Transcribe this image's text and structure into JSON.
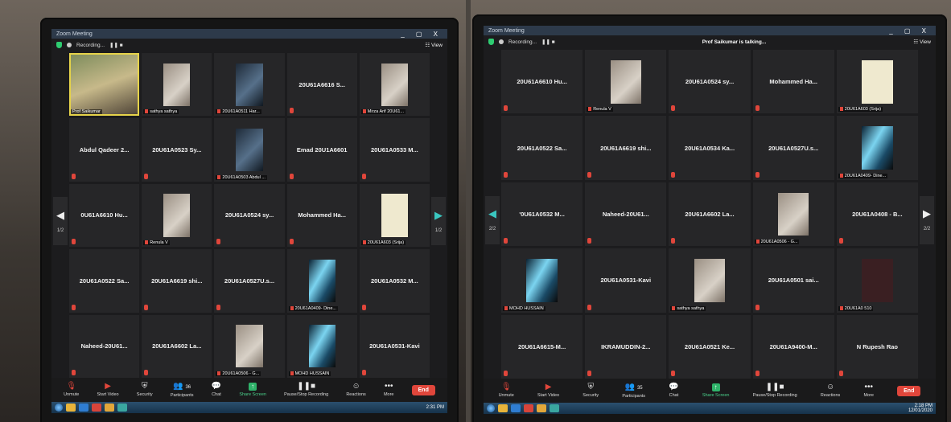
{
  "left": {
    "window_title": "Zoom Meeting",
    "window_controls": "_ ▢ X",
    "recording_label": "Recording...",
    "view_label": "View",
    "talking": "",
    "page_indicator_left": "1/2",
    "page_indicator_right": "1/2",
    "tiles": [
      {
        "kind": "video",
        "label": "Prof Saikumar",
        "active": true,
        "thumb": "full"
      },
      {
        "kind": "video",
        "label": "sathya sathya",
        "thumb": "normal"
      },
      {
        "kind": "video",
        "label": "20U61A0511 Har...",
        "thumb": "dark"
      },
      {
        "kind": "name",
        "name": "20U61A6616 S..."
      },
      {
        "kind": "video",
        "label": "Mirza Arif 20U61...",
        "thumb": "normal"
      },
      {
        "kind": "name",
        "name": "Abdul Qadeer 2..."
      },
      {
        "kind": "name",
        "name": "20U61A0523 Sy..."
      },
      {
        "kind": "video",
        "label": "20U61A0503 Abdul ...",
        "thumb": "dark"
      },
      {
        "kind": "name",
        "name": "Emad 20U1A6601"
      },
      {
        "kind": "name",
        "name": "20U61A0533 M..."
      },
      {
        "kind": "name",
        "name": "0U61A6610 Hu..."
      },
      {
        "kind": "video",
        "label": "Renula V",
        "thumb": "normal"
      },
      {
        "kind": "name",
        "name": "20U61A0524 sy..."
      },
      {
        "kind": "name",
        "name": "Mohammed Ha..."
      },
      {
        "kind": "video",
        "label": "20U61A603 (Srija)",
        "thumb": "light"
      },
      {
        "kind": "name",
        "name": "20U61A0522 Sa..."
      },
      {
        "kind": "name",
        "name": "20U61A6619 shi..."
      },
      {
        "kind": "name",
        "name": "20U61A0527U.s..."
      },
      {
        "kind": "video",
        "label": "20U61A0409- Dine...",
        "thumb": "swirl"
      },
      {
        "kind": "name",
        "name": "20U61A0532 M..."
      },
      {
        "kind": "name",
        "name": "Naheed-20U61..."
      },
      {
        "kind": "name",
        "name": "20U61A6602 La..."
      },
      {
        "kind": "video",
        "label": "20U61A0506 - G...",
        "thumb": "normal"
      },
      {
        "kind": "video",
        "label": "MOHD HUSSAIN",
        "thumb": "swirl"
      },
      {
        "kind": "name",
        "name": "20U61A0531-Kavi"
      }
    ],
    "toolbar": {
      "unmute": "Unmute",
      "start_video": "Start Video",
      "security": "Security",
      "participants": "Participants",
      "participants_count": "36",
      "chat": "Chat",
      "share_screen": "Share Screen",
      "pause_recording": "Pause/Stop Recording",
      "reactions": "Reactions",
      "more": "More",
      "end": "End"
    },
    "clock": "2:31 PM"
  },
  "right": {
    "window_title": "Zoom Meeting",
    "window_controls": "_ ▢ X",
    "recording_label": "Recording...",
    "view_label": "View",
    "talking": "Prof Saikumar is talking...",
    "page_indicator_left": "2/2",
    "page_indicator_right": "2/2",
    "tiles": [
      {
        "kind": "name",
        "name": "20U61A6610 Hu..."
      },
      {
        "kind": "video",
        "label": "Renula V",
        "thumb": "normal"
      },
      {
        "kind": "name",
        "name": "20U61A0524 sy..."
      },
      {
        "kind": "name",
        "name": "Mohammed Ha..."
      },
      {
        "kind": "video",
        "label": "20U61A603 (Srija)",
        "thumb": "light"
      },
      {
        "kind": "name",
        "name": "20U61A0522 Sa..."
      },
      {
        "kind": "name",
        "name": "20U61A6619 shi..."
      },
      {
        "kind": "name",
        "name": "20U61A0534 Ka..."
      },
      {
        "kind": "name",
        "name": "20U61A0527U.s..."
      },
      {
        "kind": "video",
        "label": "20U61A0409- Dine...",
        "thumb": "swirl"
      },
      {
        "kind": "name",
        "name": "'0U61A0532 M..."
      },
      {
        "kind": "name",
        "name": "Naheed-20U61..."
      },
      {
        "kind": "name",
        "name": "20U61A6602 La..."
      },
      {
        "kind": "video",
        "label": "20U61A0506 - G...",
        "thumb": "normal"
      },
      {
        "kind": "name",
        "name": "20U61A0408 - B..."
      },
      {
        "kind": "video",
        "label": "MOHD HUSSAIN",
        "thumb": "swirl"
      },
      {
        "kind": "name",
        "name": "20U61A0531-Kavi"
      },
      {
        "kind": "video",
        "label": "sathya sathya",
        "thumb": "normal"
      },
      {
        "kind": "name",
        "name": "20U61A0501 sai..."
      },
      {
        "kind": "video",
        "label": "20U61A0 510",
        "thumb": "maroon"
      },
      {
        "kind": "name",
        "name": "20U61A6615-M..."
      },
      {
        "kind": "name",
        "name": "IKRAMUDDIN-2..."
      },
      {
        "kind": "name",
        "name": "20U61A0521 Ke..."
      },
      {
        "kind": "name",
        "name": "20U61A9400-M..."
      },
      {
        "kind": "name",
        "name": "N Rupesh Rao"
      }
    ],
    "toolbar": {
      "unmute": "Unmute",
      "start_video": "Start Video",
      "security": "Security",
      "participants": "Participants",
      "participants_count": "35",
      "chat": "Chat",
      "share_screen": "Share Screen",
      "pause_recording": "Pause/Stop Recording",
      "reactions": "Reactions",
      "more": "More",
      "end": "End"
    },
    "clock": "2:18 PM",
    "date": "12/01/2020"
  }
}
